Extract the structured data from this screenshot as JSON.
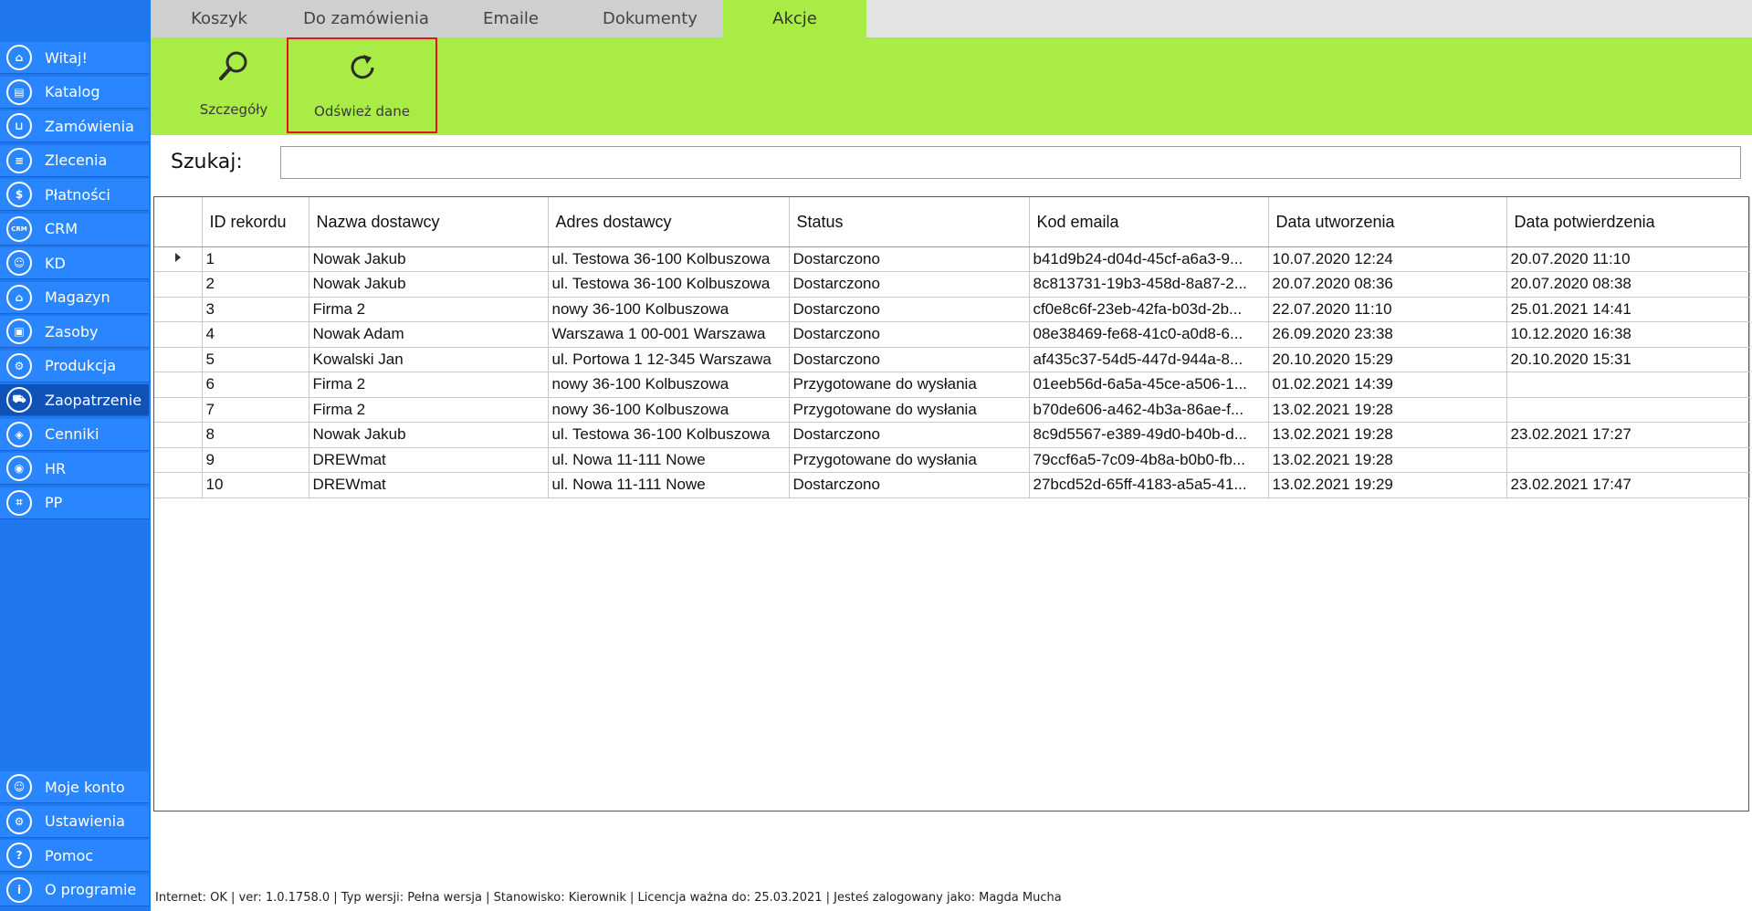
{
  "sidebar": {
    "items": [
      {
        "label": "Witaj!",
        "icon": "home-icon",
        "glyph": "⌂"
      },
      {
        "label": "Katalog",
        "icon": "book-icon",
        "glyph": "▤"
      },
      {
        "label": "Zamówienia",
        "icon": "cart-icon",
        "glyph": "⊔"
      },
      {
        "label": "Zlecenia",
        "icon": "list-icon",
        "glyph": "≡"
      },
      {
        "label": "Płatności",
        "icon": "dollar-icon",
        "glyph": "$"
      },
      {
        "label": "CRM",
        "icon": "crm-icon",
        "glyph": "CRM"
      },
      {
        "label": "KD",
        "icon": "person-icon",
        "glyph": "☺"
      },
      {
        "label": "Magazyn",
        "icon": "warehouse-icon",
        "glyph": "⌂"
      },
      {
        "label": "Zasoby",
        "icon": "resources-icon",
        "glyph": "▣"
      },
      {
        "label": "Produkcja",
        "icon": "production-icon",
        "glyph": "⚙"
      },
      {
        "label": "Zaopatrzenie",
        "icon": "supply-icon",
        "glyph": "⛟"
      },
      {
        "label": "Cenniki",
        "icon": "tag-icon",
        "glyph": "◈"
      },
      {
        "label": "HR",
        "icon": "hr-icon",
        "glyph": "◉"
      },
      {
        "label": "PP",
        "icon": "chart-icon",
        "glyph": "⌗"
      }
    ],
    "bottom_items": [
      {
        "label": "Moje konto",
        "icon": "account-icon",
        "glyph": "☺"
      },
      {
        "label": "Ustawienia",
        "icon": "settings-icon",
        "glyph": "⚙"
      },
      {
        "label": "Pomoc",
        "icon": "help-icon",
        "glyph": "?"
      },
      {
        "label": "O programie",
        "icon": "info-icon",
        "glyph": "i"
      }
    ],
    "active_label": "Zaopatrzenie"
  },
  "tabs": [
    "Koszyk",
    "Do zamówienia",
    "Emaile",
    "Dokumenty",
    "Akcje"
  ],
  "active_tab": "Akcje",
  "ribbon": {
    "details_label": "Szczegóły",
    "refresh_label": "Odśwież dane"
  },
  "search": {
    "label": "Szukaj:",
    "value": ""
  },
  "table": {
    "columns": [
      "ID rekordu",
      "Nazwa dostawcy",
      "Adres dostawcy",
      "Status",
      "Kod emaila",
      "Data utworzenia",
      "Data potwierdzenia"
    ],
    "rows": [
      [
        "1",
        "Nowak Jakub",
        "ul. Testowa 36-100 Kolbuszowa",
        "Dostarczono",
        "b41d9b24-d04d-45cf-a6a3-9...",
        "10.07.2020 12:24",
        "20.07.2020 11:10"
      ],
      [
        "2",
        "Nowak Jakub",
        "ul. Testowa 36-100 Kolbuszowa",
        "Dostarczono",
        "8c813731-19b3-458d-8a87-2...",
        "20.07.2020 08:36",
        "20.07.2020 08:38"
      ],
      [
        "3",
        " Firma 2",
        "nowy 36-100 Kolbuszowa",
        "Dostarczono",
        "cf0e8c6f-23eb-42fa-b03d-2b...",
        "22.07.2020 11:10",
        "25.01.2021 14:41"
      ],
      [
        "4",
        "Nowak Adam",
        "Warszawa 1 00-001 Warszawa",
        "Dostarczono",
        "08e38469-fe68-41c0-a0d8-6...",
        "26.09.2020 23:38",
        "10.12.2020 16:38"
      ],
      [
        "5",
        "Kowalski Jan",
        "ul. Portowa 1 12-345 Warszawa",
        "Dostarczono",
        "af435c37-54d5-447d-944a-8...",
        "20.10.2020 15:29",
        "20.10.2020 15:31"
      ],
      [
        "6",
        " Firma 2",
        "nowy 36-100 Kolbuszowa",
        "Przygotowane do wysłania",
        "01eeb56d-6a5a-45ce-a506-1...",
        "01.02.2021 14:39",
        ""
      ],
      [
        "7",
        " Firma 2",
        "nowy 36-100 Kolbuszowa",
        "Przygotowane do wysłania",
        "b70de606-a462-4b3a-86ae-f...",
        "13.02.2021 19:28",
        ""
      ],
      [
        "8",
        "Nowak Jakub",
        "ul. Testowa 36-100 Kolbuszowa",
        "Dostarczono",
        "8c9d5567-e389-49d0-b40b-d...",
        "13.02.2021 19:28",
        "23.02.2021 17:27"
      ],
      [
        "9",
        " DREWmat",
        "ul. Nowa 11-111 Nowe",
        "Przygotowane do wysłania",
        "79ccf6a5-7c09-4b8a-b0b0-fb...",
        "13.02.2021 19:28",
        ""
      ],
      [
        "10",
        " DREWmat",
        "ul. Nowa 11-111 Nowe",
        "Dostarczono",
        "27bcd52d-65ff-4183-a5a5-41...",
        "13.02.2021 19:29",
        "23.02.2021 17:47"
      ]
    ]
  },
  "statusbar": "Internet: OK  |   ver: 1.0.1758.0   |   Typ wersji: Pełna wersja   |   Stanowisko: Kierownik   |   Licencja ważna do: 25.03.2021   |   Jesteś zalogowany jako: Magda Mucha",
  "colors": {
    "sidebar": "#1f78f0",
    "accent_green": "#a8ec45",
    "highlight_border": "#e3141f"
  }
}
